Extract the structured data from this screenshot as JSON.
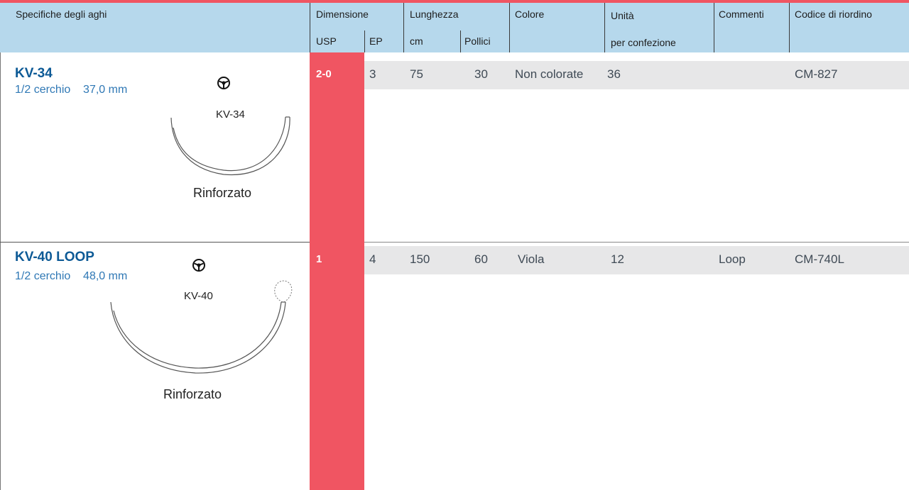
{
  "header": {
    "specs": "Specifiche degli aghi",
    "dimension": "Dimensione",
    "usp": "USP",
    "ep": "EP",
    "length": "Lunghezza",
    "cm": "cm",
    "inches": "Pollici",
    "color": "Colore",
    "units_line1": "Unità",
    "units_line2": "per confezione",
    "comments": "Commenti",
    "reorder": "Codice di riordino"
  },
  "rows": [
    {
      "needle_name": "KV-34",
      "needle_spec": "1/2 cerchio    37,0 mm",
      "needle_code": "KV-34",
      "needle_type": "Rinforzato",
      "symbol": "taper-point-symbol",
      "usp": "2-0",
      "ep": "3",
      "cm": "75",
      "inches": "30",
      "color": "Non colorate",
      "units": "36",
      "comments": "",
      "reorder": "CM-827"
    },
    {
      "needle_name": "KV-40 LOOP",
      "needle_spec": "1/2 cerchio    48,0 mm",
      "needle_code": "KV-40",
      "needle_type": "Rinforzato",
      "symbol": "taper-point-symbol",
      "usp": "1",
      "ep": "4",
      "cm": "150",
      "inches": "60",
      "color": "Viola",
      "units": "12",
      "comments": "Loop",
      "reorder": "CM-740L"
    }
  ],
  "colors": {
    "accent_red": "#f05562",
    "header_blue": "#b6d8ec",
    "row_grey": "#e7e7e8",
    "name_blue": "#0d5a96"
  }
}
